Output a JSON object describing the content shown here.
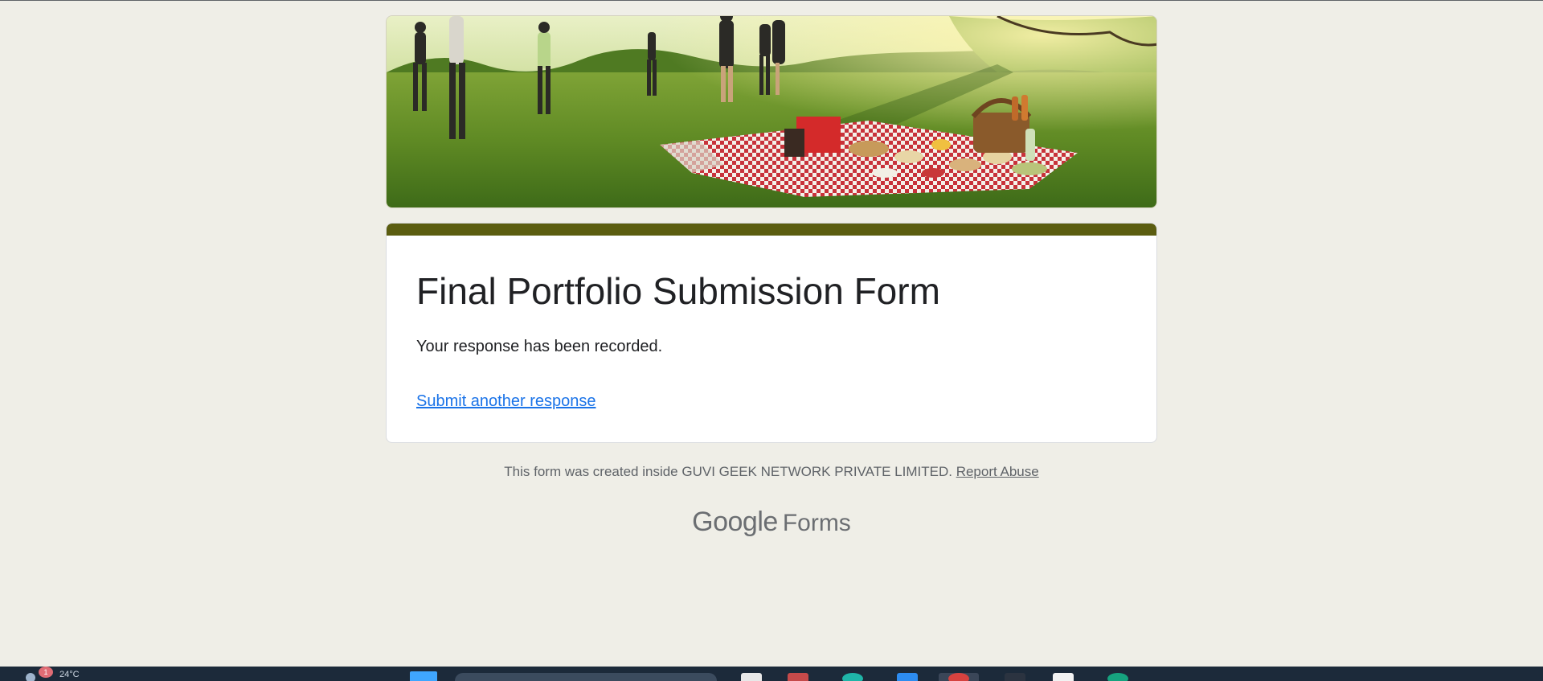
{
  "form": {
    "title": "Final Portfolio Submission Form",
    "message": "Your response has been recorded.",
    "link_label": "Submit another response",
    "accent_color": "#5b5d10",
    "link_color": "#1a73e8",
    "background_color": "#efeee7",
    "banner_image": "picnic-in-a-grassy-field"
  },
  "footer": {
    "note": "This form was created inside GUVI GEEK NETWORK PRIVATE LIMITED.",
    "report_label": "Report Abuse"
  },
  "brand": {
    "google_word": "Google",
    "product_word": "Forms"
  },
  "taskbar": {
    "notification_count": "1",
    "temperature": "24°C",
    "icons": [
      "weather-icon",
      "start-menu-icon",
      "search-box",
      "task-view-icon",
      "file-explorer-icon",
      "browser-icon",
      "edge-icon",
      "store-icon",
      "chrome-icon",
      "app-icon",
      "terminal-icon",
      "notepad-icon",
      "chatgpt-icon"
    ]
  }
}
